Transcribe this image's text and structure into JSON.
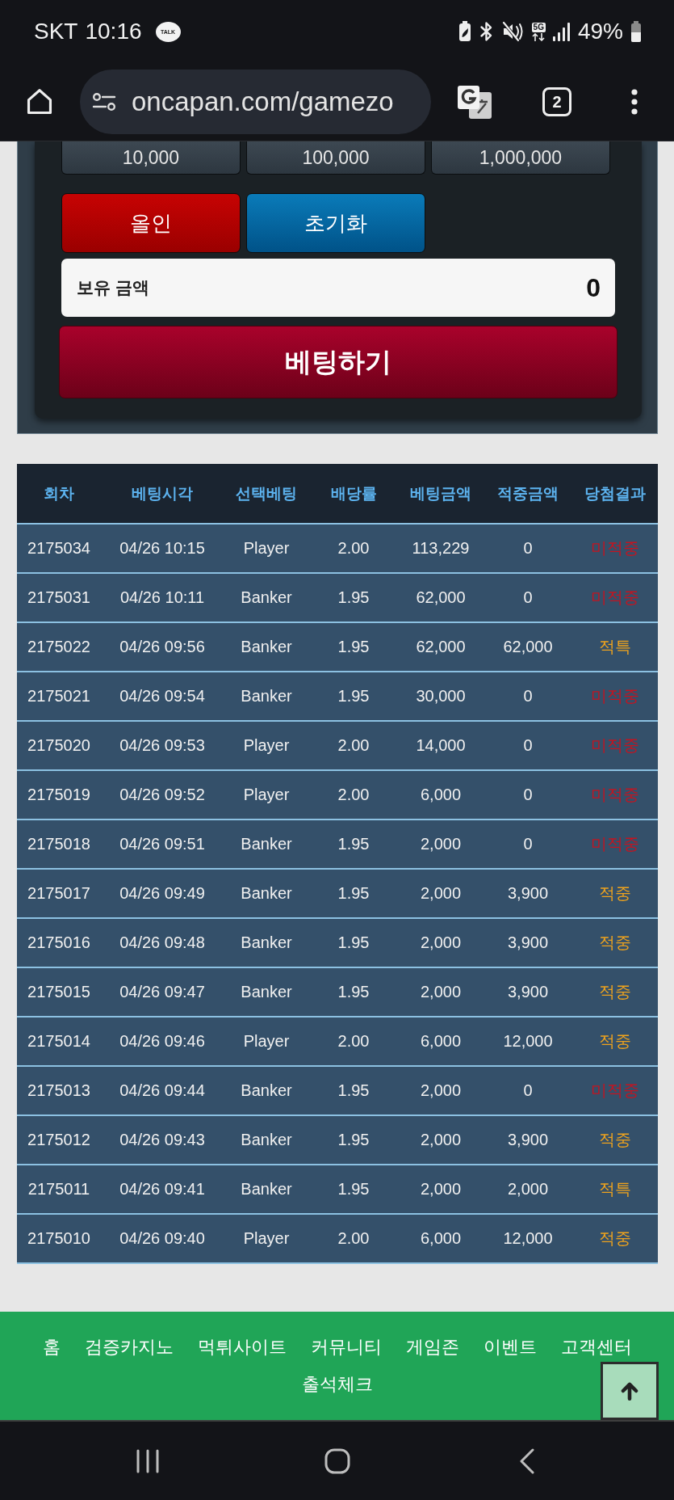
{
  "status_bar": {
    "carrier": "SKT",
    "time": "10:16",
    "notification": "TALK",
    "network": "5G",
    "battery": "49%"
  },
  "browser": {
    "url": "oncapan.com/gamezo",
    "tab_count": "2"
  },
  "bet_panel": {
    "amount_buttons": [
      "10,000",
      "100,000",
      "1,000,000"
    ],
    "action_buttons": [
      {
        "label": "올인",
        "kind": "allin"
      },
      {
        "label": "초기화",
        "kind": "reset"
      }
    ],
    "balance": {
      "label": "보유 금액",
      "value": "0"
    },
    "bet_button": "베팅하기"
  },
  "table": {
    "columns": [
      "회차",
      "베팅시각",
      "선택베팅",
      "배당률",
      "베팅금액",
      "적중금액",
      "당첨결과"
    ],
    "rows": [
      {
        "cells": [
          "2175034",
          "04/26 10:15",
          "Player",
          "2.00",
          "113,229",
          "0"
        ],
        "result": {
          "text": "미적중",
          "color": "#c41420"
        }
      },
      {
        "cells": [
          "2175031",
          "04/26 10:11",
          "Banker",
          "1.95",
          "62,000",
          "0"
        ],
        "result": {
          "text": "미적중",
          "color": "#c41420"
        }
      },
      {
        "cells": [
          "2175022",
          "04/26 09:56",
          "Banker",
          "1.95",
          "62,000",
          "62,000"
        ],
        "result": {
          "text": "적특",
          "color": "#efa31d"
        }
      },
      {
        "cells": [
          "2175021",
          "04/26 09:54",
          "Banker",
          "1.95",
          "30,000",
          "0"
        ],
        "result": {
          "text": "미적중",
          "color": "#c41420"
        }
      },
      {
        "cells": [
          "2175020",
          "04/26 09:53",
          "Player",
          "2.00",
          "14,000",
          "0"
        ],
        "result": {
          "text": "미적중",
          "color": "#c41420"
        }
      },
      {
        "cells": [
          "2175019",
          "04/26 09:52",
          "Player",
          "2.00",
          "6,000",
          "0"
        ],
        "result": {
          "text": "미적중",
          "color": "#c41420"
        }
      },
      {
        "cells": [
          "2175018",
          "04/26 09:51",
          "Banker",
          "1.95",
          "2,000",
          "0"
        ],
        "result": {
          "text": "미적중",
          "color": "#c41420"
        }
      },
      {
        "cells": [
          "2175017",
          "04/26 09:49",
          "Banker",
          "1.95",
          "2,000",
          "3,900"
        ],
        "result": {
          "text": "적중",
          "color": "#efa31d"
        }
      },
      {
        "cells": [
          "2175016",
          "04/26 09:48",
          "Banker",
          "1.95",
          "2,000",
          "3,900"
        ],
        "result": {
          "text": "적중",
          "color": "#efa31d"
        }
      },
      {
        "cells": [
          "2175015",
          "04/26 09:47",
          "Banker",
          "1.95",
          "2,000",
          "3,900"
        ],
        "result": {
          "text": "적중",
          "color": "#efa31d"
        }
      },
      {
        "cells": [
          "2175014",
          "04/26 09:46",
          "Player",
          "2.00",
          "6,000",
          "12,000"
        ],
        "result": {
          "text": "적중",
          "color": "#efa31d"
        }
      },
      {
        "cells": [
          "2175013",
          "04/26 09:44",
          "Banker",
          "1.95",
          "2,000",
          "0"
        ],
        "result": {
          "text": "미적중",
          "color": "#c41420"
        }
      },
      {
        "cells": [
          "2175012",
          "04/26 09:43",
          "Banker",
          "1.95",
          "2,000",
          "3,900"
        ],
        "result": {
          "text": "적중",
          "color": "#efa31d"
        }
      },
      {
        "cells": [
          "2175011",
          "04/26 09:41",
          "Banker",
          "1.95",
          "2,000",
          "2,000"
        ],
        "result": {
          "text": "적특",
          "color": "#efa31d"
        }
      },
      {
        "cells": [
          "2175010",
          "04/26 09:40",
          "Player",
          "2.00",
          "6,000",
          "12,000"
        ],
        "result": {
          "text": "적중",
          "color": "#efa31d"
        }
      }
    ]
  },
  "footer": {
    "links": [
      "홈",
      "검증카지노",
      "먹튀사이트",
      "커뮤니티",
      "게임존",
      "이벤트",
      "고객센터",
      "출석체크"
    ]
  }
}
